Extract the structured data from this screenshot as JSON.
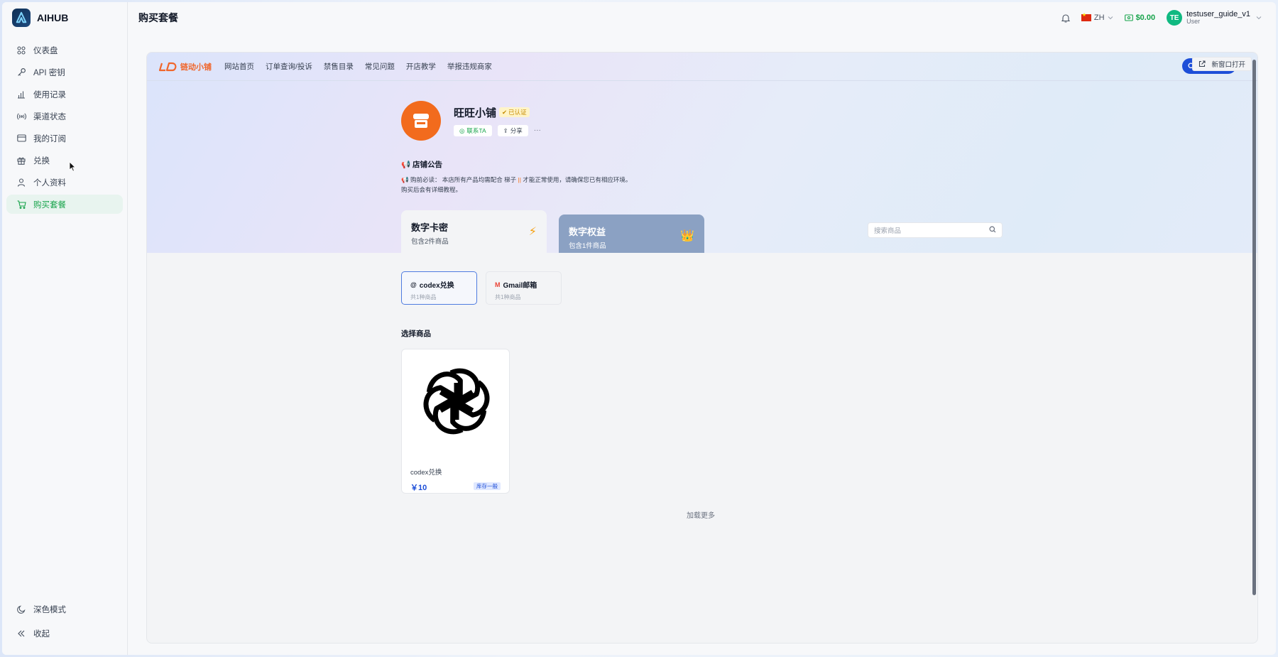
{
  "sidebar": {
    "brand": "AIHUB",
    "items": [
      {
        "label": "仪表盘",
        "icon": "dashboard-icon"
      },
      {
        "label": "API 密钥",
        "icon": "key-icon"
      },
      {
        "label": "使用记录",
        "icon": "bar-chart-icon"
      },
      {
        "label": "渠道状态",
        "icon": "signal-icon"
      },
      {
        "label": "我的订阅",
        "icon": "card-icon"
      },
      {
        "label": "兑换",
        "icon": "gift-icon"
      },
      {
        "label": "个人资料",
        "icon": "user-icon"
      },
      {
        "label": "购买套餐",
        "icon": "cart-icon",
        "active": true
      }
    ],
    "dark_mode": "深色模式",
    "collapse": "收起"
  },
  "header": {
    "title": "购买套餐",
    "language": "ZH",
    "balance": "$0.00",
    "avatar_initials": "TE",
    "user_name": "testuser_guide_v1",
    "user_role": "User"
  },
  "shop": {
    "logo_text": "链动小铺",
    "nav": [
      "网站首页",
      "订单查询/投诉",
      "禁售目录",
      "常见问题",
      "开店教学",
      "举报违规商家"
    ],
    "new_window": "新窗口打开",
    "name": "旺旺小铺",
    "verified": "已认证",
    "contact": "联系TA",
    "share": "分享",
    "more": "···",
    "notice_title": "📢 店铺公告",
    "notice_line1_prefix": "📢 购前必读：  本店所有产品均需配合 梯子 ",
    "notice_bars": "||",
    "notice_line1_suffix": " 才能正常使用，请确保您已有相应环境。",
    "notice_line2": "购买后会有详细教程。",
    "tabs": [
      {
        "title": "数字卡密",
        "sub": "包含2件商品",
        "icon": "⚡"
      },
      {
        "title": "数字权益",
        "sub": "包含1件商品",
        "icon": "👑"
      }
    ],
    "search_placeholder": "搜索商品",
    "subcategories": [
      {
        "title": "codex兑换",
        "sub": "共1种商品"
      },
      {
        "title": "Gmail邮箱",
        "sub": "共1种商品"
      }
    ],
    "select_label": "选择商品",
    "product": {
      "name": "codex兑换",
      "price": "￥10",
      "stock": "库存一般"
    },
    "load_more": "加载更多"
  }
}
